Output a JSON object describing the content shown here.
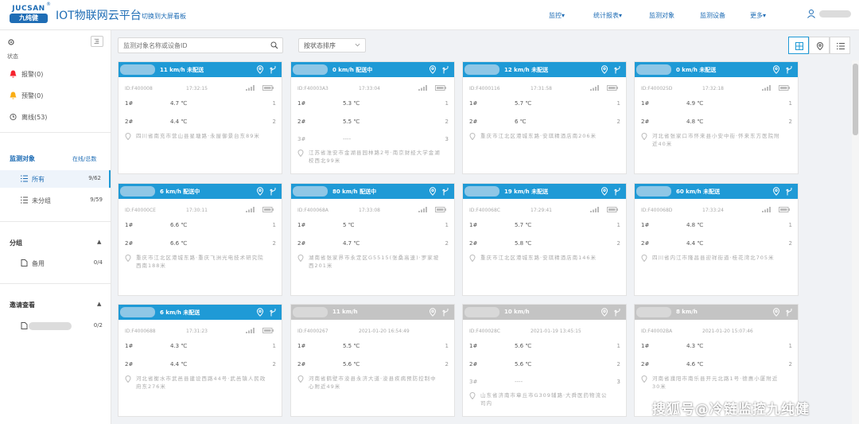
{
  "header": {
    "logo_top": "JUCSAN",
    "logo_bottom": "九纯健",
    "logo_reg": "®",
    "title": "IOT物联网云平台",
    "switch_link": "切换到大屏看板",
    "nav": [
      {
        "label": "监控▾"
      },
      {
        "label": "统计报表▾"
      },
      {
        "label": "监测对象"
      },
      {
        "label": "监测设备"
      },
      {
        "label": "更多▾"
      }
    ]
  },
  "sidebar": {
    "status_label": "状态",
    "alarms": [
      {
        "label": "报警(0)",
        "color": "#f5222d"
      },
      {
        "label": "预警(0)",
        "color": "#faad14"
      },
      {
        "label": "离线(53)",
        "color": "#555555"
      }
    ],
    "monitor": {
      "title": "监测对象",
      "right": "在线/总数"
    },
    "monitor_items": [
      {
        "label": "所有",
        "count": "9/62",
        "active": true
      },
      {
        "label": "未分组",
        "count": "9/59",
        "active": false
      }
    ],
    "group": {
      "title": "分组"
    },
    "group_items": [
      {
        "label": "备用",
        "count": "0/4"
      }
    ],
    "invite": {
      "title": "邀请查看"
    },
    "invite_items": [
      {
        "count": "0/2"
      }
    ]
  },
  "toolbar": {
    "search_placeholder": "监测对象名称或设备ID",
    "sort_label": "按状态排序"
  },
  "cards": [
    {
      "head": "11 km/h 未配送",
      "online": true,
      "id": "ID:F400008",
      "time": "17:32:15",
      "rows": [
        {
          "lbl": "1#",
          "val": "4.7 ℃",
          "num": "1"
        },
        {
          "lbl": "2#",
          "val": "4.4 ℃",
          "num": "2"
        }
      ],
      "addr": "四川省南充市营山县星塘路·永屋御景台东89米"
    },
    {
      "head": "0 km/h 配送中",
      "online": true,
      "id": "ID:F40003A3",
      "time": "17:33:04",
      "rows": [
        {
          "lbl": "1#",
          "val": "5.3 ℃",
          "num": "1"
        },
        {
          "lbl": "2#",
          "val": "5.5 ℃",
          "num": "2"
        },
        {
          "lbl": "3#",
          "val": "----",
          "num": "3"
        }
      ],
      "addr": "江苏省淮安市金湖县园林路2号·南京财经大学金湖校西北99米"
    },
    {
      "head": "12 km/h 未配送",
      "online": true,
      "id": "ID:F4000116",
      "time": "17:31:58",
      "rows": [
        {
          "lbl": "1#",
          "val": "5.7 ℃",
          "num": "1"
        },
        {
          "lbl": "2#",
          "val": "6 ℃",
          "num": "2"
        }
      ],
      "addr": "重庆市江北区港城东路·安琪精酒店南206米"
    },
    {
      "head": "0 km/h 未配送",
      "online": true,
      "id": "ID:F400025D",
      "time": "17:32:18",
      "rows": [
        {
          "lbl": "1#",
          "val": "4.9 ℃",
          "num": "1"
        },
        {
          "lbl": "2#",
          "val": "4.8 ℃",
          "num": "2"
        }
      ],
      "addr": "河北省张家口市怀来县小安中街·怀来东方医院附近40米"
    },
    {
      "head": "6 km/h 配送中",
      "online": true,
      "id": "ID:F40000CE",
      "time": "17:30:11",
      "rows": [
        {
          "lbl": "1#",
          "val": "6.6 ℃",
          "num": "1"
        },
        {
          "lbl": "2#",
          "val": "6.6 ℃",
          "num": "2"
        }
      ],
      "addr": "重庆市江北区港城东路·重庆飞洲光电技术研究院西南188米"
    },
    {
      "head": "80 km/h 配送中",
      "online": true,
      "id": "ID:F400068A",
      "time": "17:33:08",
      "rows": [
        {
          "lbl": "1#",
          "val": "5 ℃",
          "num": "1"
        },
        {
          "lbl": "2#",
          "val": "4.7 ℃",
          "num": "2"
        }
      ],
      "addr": "湖南省张家界市永定区G5515(张桑高速)·罗家坡西201米"
    },
    {
      "head": "19 km/h 未配送",
      "online": true,
      "id": "ID:F400068C",
      "time": "17:29:41",
      "rows": [
        {
          "lbl": "1#",
          "val": "5.7 ℃",
          "num": "1"
        },
        {
          "lbl": "2#",
          "val": "5.8 ℃",
          "num": "2"
        }
      ],
      "addr": "重庆市江北区港城东路·安琪精酒店南146米"
    },
    {
      "head": "60 km/h 未配送",
      "online": true,
      "id": "ID:F400068D",
      "time": "17:33:24",
      "rows": [
        {
          "lbl": "1#",
          "val": "4.8 ℃",
          "num": "1"
        },
        {
          "lbl": "2#",
          "val": "4.4 ℃",
          "num": "2"
        }
      ],
      "addr": "四川省内江市隆昌县迎祥街道·桂花湾北705米"
    },
    {
      "head": "6 km/h 未配送",
      "online": true,
      "id": "ID:F4000688",
      "time": "17:31:23",
      "rows": [
        {
          "lbl": "1#",
          "val": "4.3 ℃",
          "num": "1"
        },
        {
          "lbl": "2#",
          "val": "4.4 ℃",
          "num": "2"
        }
      ],
      "addr": "河北省衡水市武邑县建设西路44号·武邑镇人民政府东276米"
    },
    {
      "head": "11 km/h",
      "online": false,
      "id": "ID:F4000267",
      "time": "2021-01-20 16:54:49",
      "rows": [
        {
          "lbl": "1#",
          "val": "5.5 ℃",
          "num": "1"
        },
        {
          "lbl": "2#",
          "val": "5.6 ℃",
          "num": "2"
        }
      ],
      "addr": "河南省鹤壁市浚县永济大道·浚县疾病预防控制中心附近49米"
    },
    {
      "head": "10 km/h",
      "online": false,
      "id": "ID:F400028C",
      "time": "2021-01-19 13:45:15",
      "rows": [
        {
          "lbl": "1#",
          "val": "5.6 ℃",
          "num": "1"
        },
        {
          "lbl": "2#",
          "val": "5.6 ℃",
          "num": "2"
        },
        {
          "lbl": "3#",
          "val": "----",
          "num": "3"
        }
      ],
      "addr": "山东省济南市章丘市G309辅路·大舜医药物流公司内"
    },
    {
      "head": "8 km/h",
      "online": false,
      "id": "ID:F40002BA",
      "time": "2021-01-20 15:07:46",
      "rows": [
        {
          "lbl": "1#",
          "val": "4.3 ℃",
          "num": "1"
        },
        {
          "lbl": "2#",
          "val": "4.6 ℃",
          "num": "2"
        }
      ],
      "addr": "河南省濮阳市南乐县开元北路1号·德惠小厦附近30米"
    }
  ],
  "watermark": "搜狐号@冷链监控九纯健"
}
